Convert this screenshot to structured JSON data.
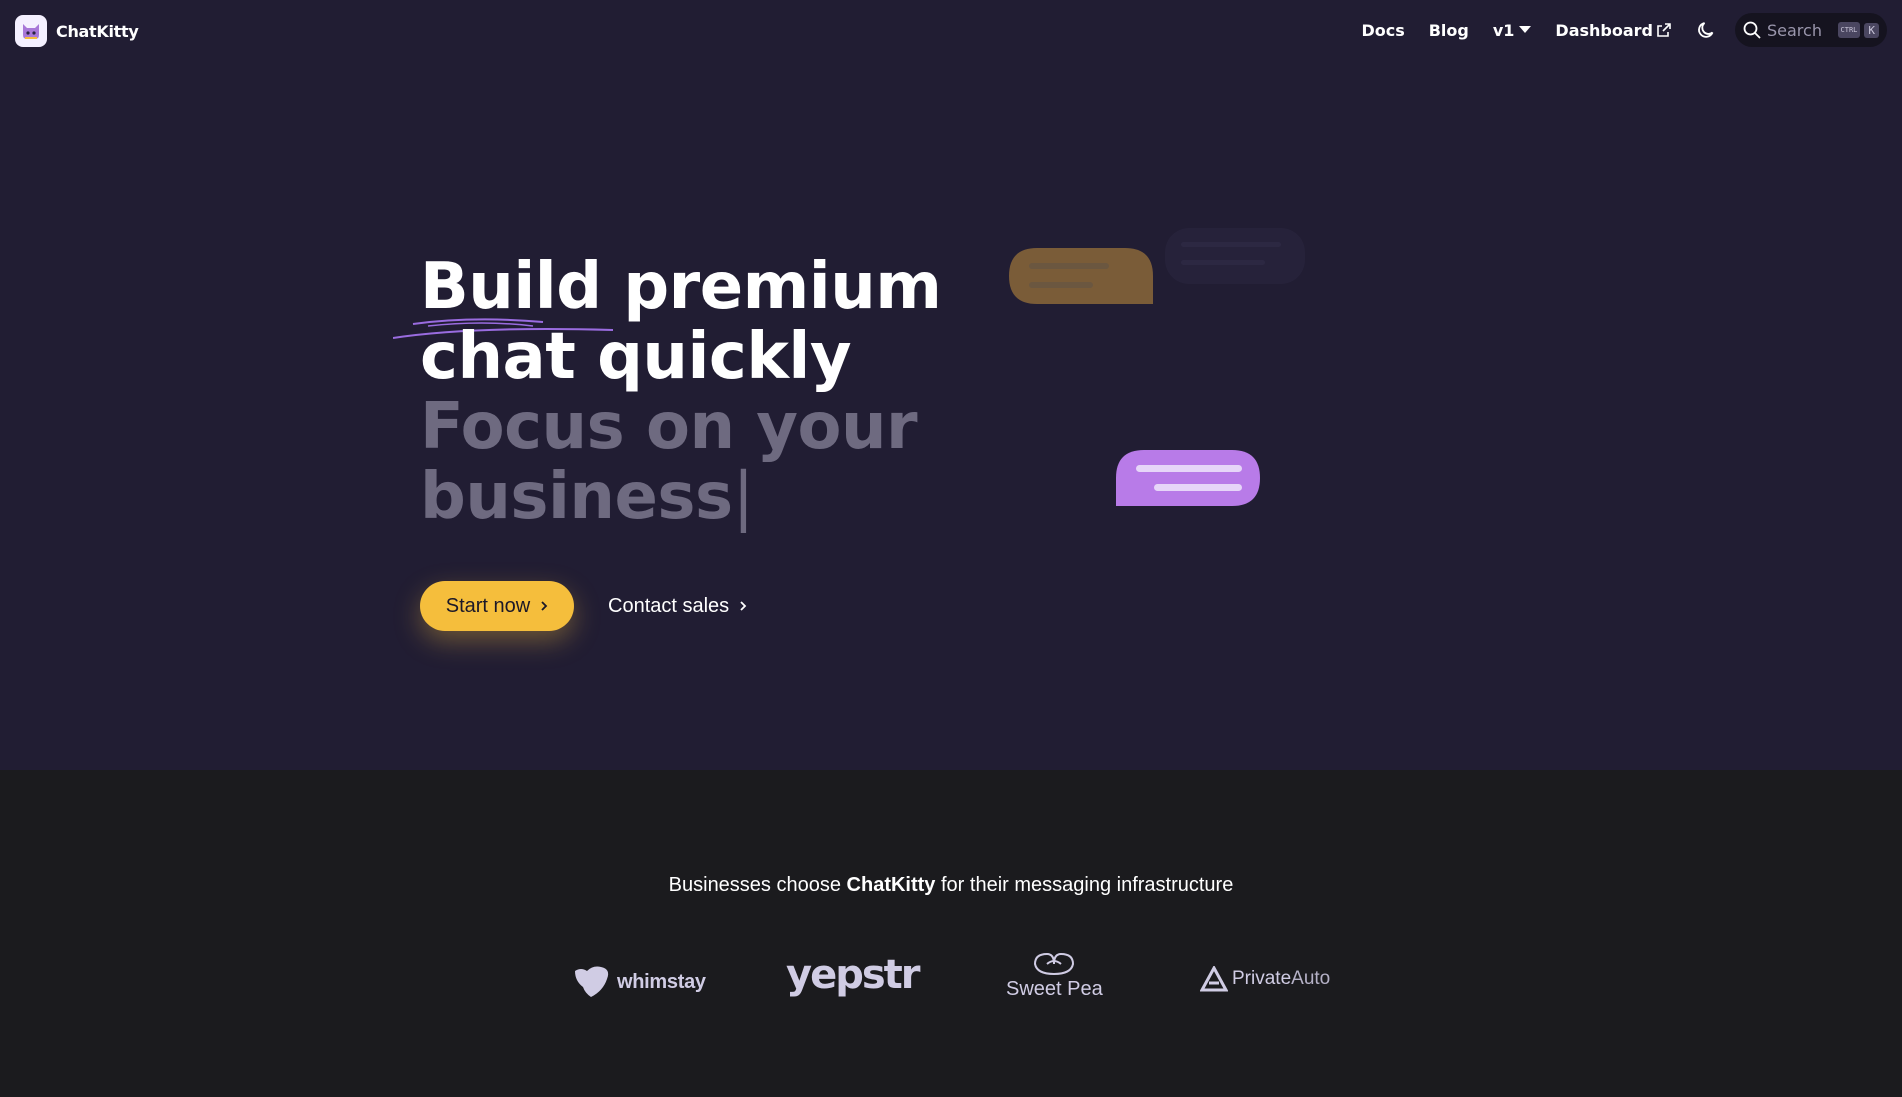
{
  "nav": {
    "brand": "ChatKitty",
    "links": [
      "Docs",
      "Blog"
    ],
    "version": "v1",
    "dashboard": "Dashboard",
    "search_placeholder": "Search",
    "search_kbd_ctrl": "CTRL",
    "search_kbd_k": "K",
    "icons": [
      "external-link-icon",
      "moon-icon",
      "search-icon",
      "chevron-down-icon"
    ]
  },
  "hero": {
    "title_line1": "Build premium",
    "title_line2": "chat quickly",
    "sub_line1": "Focus on your",
    "sub_line2": "business",
    "cursor": "|",
    "start_button": "Start now",
    "contact_link": "Contact sales",
    "colors": {
      "accent": "#f5be3c",
      "purple": "#b87be8",
      "bubble_orange": "#7a5c38",
      "scribble": "#9a6ce0"
    }
  },
  "trust": {
    "prefix": "Businesses choose ",
    "brand": "ChatKitty",
    "suffix": " for their messaging infrastructure",
    "logos": {
      "whimstay": "whimstay",
      "yepstr": "yepstr",
      "sweetpea": "Sweet Pea",
      "private": "Private",
      "auto": "Auto"
    }
  }
}
